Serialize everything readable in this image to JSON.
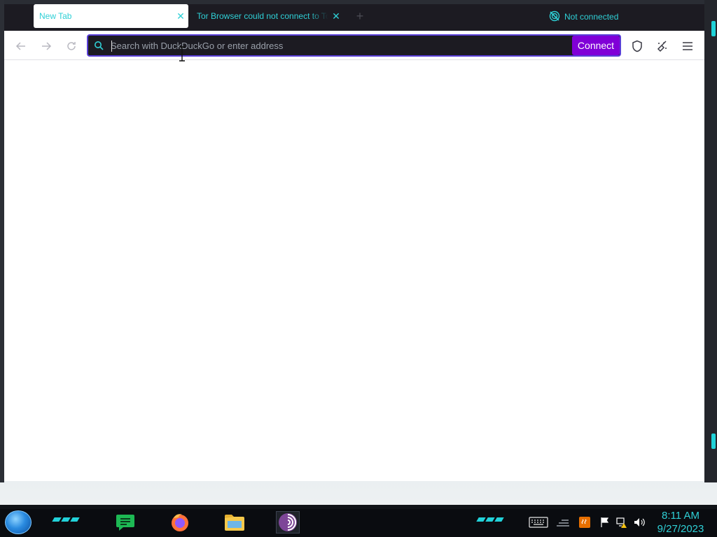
{
  "tabs": [
    {
      "label": "New Tab",
      "active": true
    },
    {
      "label": "Tor Browser could not connect to Tor",
      "active": false
    }
  ],
  "connection_status": "Not connected",
  "urlbar": {
    "placeholder": "Search with DuckDuckGo or enter address",
    "value": ""
  },
  "connect_button": "Connect",
  "colors": {
    "accent": "#2fd0d6",
    "connect": "#8000d7",
    "urlbar_border": "#5a3fd8"
  },
  "clock": {
    "time": "8:11 AM",
    "date": "9/27/2023"
  },
  "taskbar_apps": [
    "notes-icon",
    "firefox-icon",
    "file-explorer-icon",
    "tor-browser-icon"
  ]
}
